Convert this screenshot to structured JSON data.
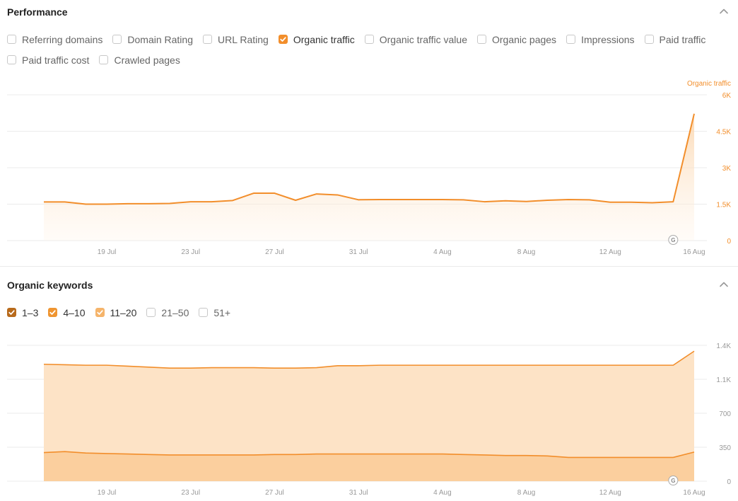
{
  "performance": {
    "title": "Performance",
    "filters": [
      {
        "label": "Referring domains",
        "checked": false
      },
      {
        "label": "Domain Rating",
        "checked": false
      },
      {
        "label": "URL Rating",
        "checked": false
      },
      {
        "label": "Organic traffic",
        "checked": true
      },
      {
        "label": "Organic traffic value",
        "checked": false
      },
      {
        "label": "Organic pages",
        "checked": false
      },
      {
        "label": "Impressions",
        "checked": false
      },
      {
        "label": "Paid traffic",
        "checked": false
      },
      {
        "label": "Paid traffic cost",
        "checked": false
      },
      {
        "label": "Crawled pages",
        "checked": false
      }
    ],
    "series_label": "Organic traffic",
    "google_marker": "G"
  },
  "keywords": {
    "title": "Organic keywords",
    "filters": [
      {
        "label": "1–3",
        "checked": true,
        "color": "#b86a1b"
      },
      {
        "label": "4–10",
        "checked": true,
        "color": "#ef9531"
      },
      {
        "label": "11–20",
        "checked": true,
        "color": "#f5b46b"
      },
      {
        "label": "21–50",
        "checked": false
      },
      {
        "label": "51+",
        "checked": false
      }
    ],
    "google_marker": "G"
  },
  "colors": {
    "accent": "#f28e2b",
    "area_light": "#fde3c6",
    "area_mid": "#fbcf9e",
    "grid": "#ebebeb"
  },
  "icons": {
    "collapse": "chevron-up-icon",
    "google_update": "google-update-icon"
  },
  "chart_data": [
    {
      "type": "area",
      "title": "",
      "x_tick_labels": [
        "19 Jul",
        "23 Jul",
        "27 Jul",
        "31 Jul",
        "4 Aug",
        "8 Aug",
        "12 Aug",
        "16 Aug"
      ],
      "x": [
        "16 Jul",
        "17 Jul",
        "18 Jul",
        "19 Jul",
        "20 Jul",
        "21 Jul",
        "22 Jul",
        "23 Jul",
        "24 Jul",
        "25 Jul",
        "26 Jul",
        "27 Jul",
        "28 Jul",
        "29 Jul",
        "30 Jul",
        "31 Jul",
        "1 Aug",
        "2 Aug",
        "3 Aug",
        "4 Aug",
        "5 Aug",
        "6 Aug",
        "7 Aug",
        "8 Aug",
        "9 Aug",
        "10 Aug",
        "11 Aug",
        "12 Aug",
        "13 Aug",
        "14 Aug",
        "15 Aug",
        "16 Aug"
      ],
      "y_tick_labels": [
        "0",
        "1.5K",
        "3K",
        "4.5K",
        "6K"
      ],
      "ylim": [
        0,
        6000
      ],
      "y_axis_label": "Organic traffic",
      "series": [
        {
          "name": "Organic traffic",
          "values": [
            1590,
            1590,
            1500,
            1500,
            1520,
            1520,
            1530,
            1600,
            1600,
            1650,
            1950,
            1950,
            1660,
            1920,
            1880,
            1680,
            1690,
            1690,
            1690,
            1690,
            1680,
            1600,
            1640,
            1610,
            1660,
            1690,
            1680,
            1580,
            1580,
            1560,
            1600,
            5220
          ]
        }
      ]
    },
    {
      "type": "area",
      "title": "",
      "x_tick_labels": [
        "19 Jul",
        "23 Jul",
        "27 Jul",
        "31 Jul",
        "4 Aug",
        "8 Aug",
        "12 Aug",
        "16 Aug"
      ],
      "x": [
        "16 Jul",
        "17 Jul",
        "18 Jul",
        "19 Jul",
        "20 Jul",
        "21 Jul",
        "22 Jul",
        "23 Jul",
        "24 Jul",
        "25 Jul",
        "26 Jul",
        "27 Jul",
        "28 Jul",
        "29 Jul",
        "30 Jul",
        "31 Jul",
        "1 Aug",
        "2 Aug",
        "3 Aug",
        "4 Aug",
        "5 Aug",
        "6 Aug",
        "7 Aug",
        "8 Aug",
        "9 Aug",
        "10 Aug",
        "11 Aug",
        "12 Aug",
        "13 Aug",
        "14 Aug",
        "15 Aug",
        "16 Aug"
      ],
      "y_tick_labels": [
        "0",
        "350",
        "700",
        "1.1K",
        "1.4K"
      ],
      "ylim": [
        0,
        1400
      ],
      "stacked": true,
      "series": [
        {
          "name": "1–3",
          "values": [
            295,
            305,
            290,
            285,
            280,
            275,
            270,
            270,
            270,
            270,
            270,
            275,
            275,
            280,
            280,
            280,
            280,
            280,
            280,
            280,
            275,
            270,
            265,
            265,
            260,
            245,
            245,
            245,
            245,
            245,
            245,
            300
          ]
        },
        {
          "name": "4–10",
          "values": [
            910,
            895,
            905,
            910,
            905,
            900,
            895,
            895,
            900,
            900,
            900,
            890,
            890,
            890,
            910,
            910,
            915,
            915,
            915,
            915,
            920,
            925,
            930,
            930,
            935,
            950,
            950,
            950,
            950,
            950,
            950,
            1040
          ]
        }
      ]
    }
  ]
}
